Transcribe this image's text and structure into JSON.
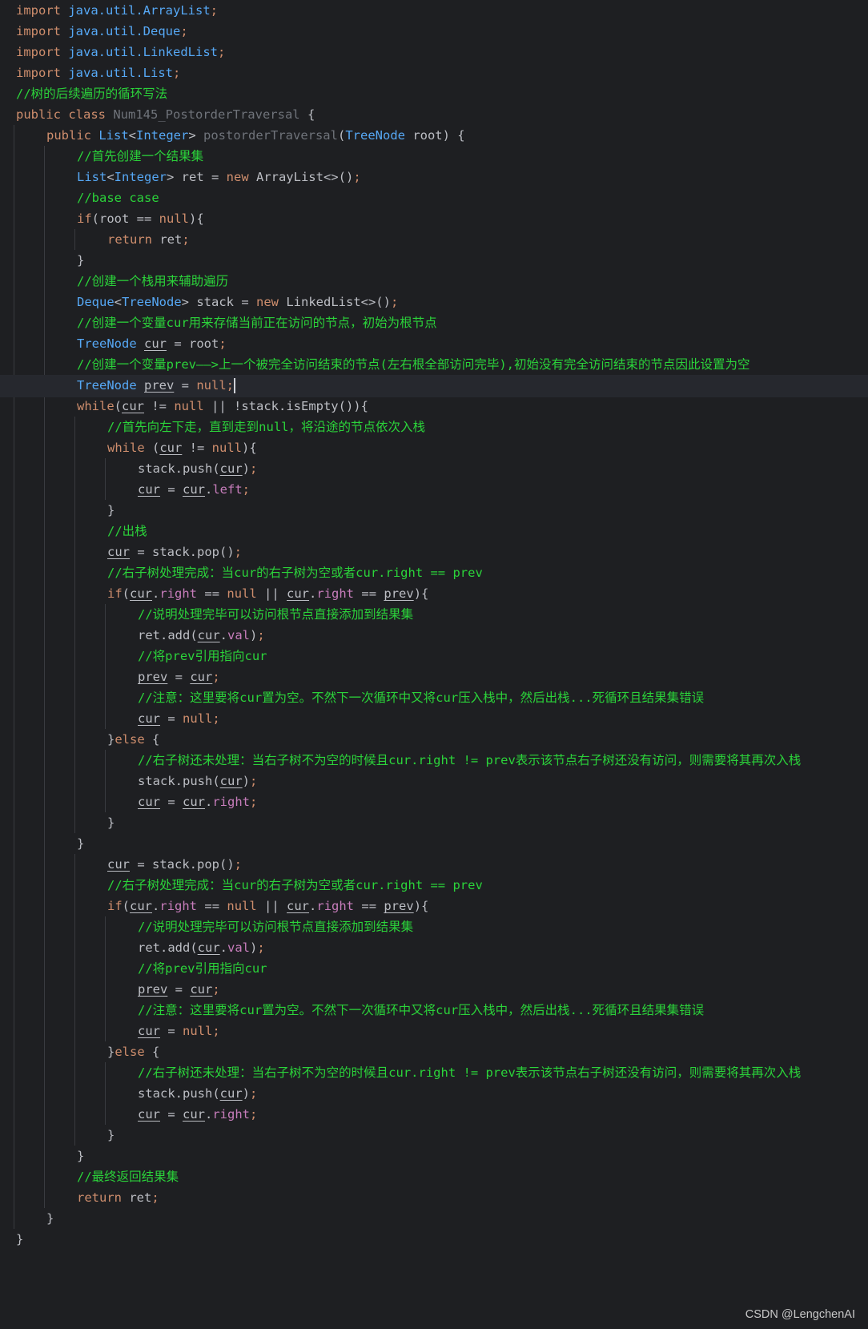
{
  "editor": {
    "lines": [
      {
        "indent": 0,
        "tokens": [
          {
            "t": "import",
            "c": "kw"
          },
          {
            "t": " "
          },
          {
            "t": "java.util.ArrayList",
            "c": "ty"
          },
          {
            "t": ";",
            "c": "kw"
          }
        ]
      },
      {
        "indent": 0,
        "tokens": [
          {
            "t": "import",
            "c": "kw"
          },
          {
            "t": " "
          },
          {
            "t": "java.util.Deque",
            "c": "ty"
          },
          {
            "t": ";",
            "c": "kw"
          }
        ]
      },
      {
        "indent": 0,
        "tokens": [
          {
            "t": "import",
            "c": "kw"
          },
          {
            "t": " "
          },
          {
            "t": "java.util.LinkedList",
            "c": "ty"
          },
          {
            "t": ";",
            "c": "kw"
          }
        ]
      },
      {
        "indent": 0,
        "tokens": [
          {
            "t": "import",
            "c": "kw"
          },
          {
            "t": " "
          },
          {
            "t": "java.util.List",
            "c": "ty"
          },
          {
            "t": ";",
            "c": "kw"
          }
        ]
      },
      {
        "indent": 0,
        "tokens": [
          {
            "t": "//树的后续遍历的循环写法",
            "c": "cm"
          }
        ]
      },
      {
        "indent": 0,
        "tokens": [
          {
            "t": "public class ",
            "c": "kw"
          },
          {
            "t": "Num145_PostorderTraversal",
            "c": "cls"
          },
          {
            "t": " {"
          }
        ]
      },
      {
        "indent": 1,
        "tokens": [
          {
            "t": "public ",
            "c": "kw"
          },
          {
            "t": "List",
            "c": "ty"
          },
          {
            "t": "<"
          },
          {
            "t": "Integer",
            "c": "ty"
          },
          {
            "t": "> "
          },
          {
            "t": "postorderTraversal",
            "c": "cls"
          },
          {
            "t": "("
          },
          {
            "t": "TreeNode",
            "c": "ty"
          },
          {
            "t": " root) {"
          }
        ]
      },
      {
        "indent": 2,
        "tokens": [
          {
            "t": "//首先创建一个结果集",
            "c": "cm"
          }
        ]
      },
      {
        "indent": 2,
        "tokens": [
          {
            "t": "List",
            "c": "ty"
          },
          {
            "t": "<"
          },
          {
            "t": "Integer",
            "c": "ty"
          },
          {
            "t": "> ret = "
          },
          {
            "t": "new ",
            "c": "kw"
          },
          {
            "t": "ArrayList<>()"
          },
          {
            "t": ";",
            "c": "kw"
          }
        ]
      },
      {
        "indent": 2,
        "tokens": [
          {
            "t": "//base case",
            "c": "cm"
          }
        ]
      },
      {
        "indent": 2,
        "tokens": [
          {
            "t": "if",
            "c": "kw"
          },
          {
            "t": "(root == "
          },
          {
            "t": "null",
            "c": "kw"
          },
          {
            "t": "){"
          }
        ]
      },
      {
        "indent": 3,
        "tokens": [
          {
            "t": "return ",
            "c": "kw"
          },
          {
            "t": "ret"
          },
          {
            "t": ";",
            "c": "kw"
          }
        ]
      },
      {
        "indent": 2,
        "tokens": [
          {
            "t": "}"
          }
        ]
      },
      {
        "indent": 2,
        "tokens": [
          {
            "t": "//创建一个栈用来辅助遍历",
            "c": "cm"
          }
        ]
      },
      {
        "indent": 2,
        "tokens": [
          {
            "t": "Deque",
            "c": "ty"
          },
          {
            "t": "<"
          },
          {
            "t": "TreeNode",
            "c": "ty"
          },
          {
            "t": "> stack = "
          },
          {
            "t": "new ",
            "c": "kw"
          },
          {
            "t": "LinkedList<>()"
          },
          {
            "t": ";",
            "c": "kw"
          }
        ]
      },
      {
        "indent": 2,
        "tokens": [
          {
            "t": "//创建一个变量cur用来存储当前正在访问的节点，初始为根节点",
            "c": "cm"
          }
        ]
      },
      {
        "indent": 2,
        "tokens": [
          {
            "t": "TreeNode",
            "c": "ty"
          },
          {
            "t": " "
          },
          {
            "t": "cur",
            "u": 1
          },
          {
            "t": " = root"
          },
          {
            "t": ";",
            "c": "kw"
          }
        ]
      },
      {
        "indent": 2,
        "tokens": [
          {
            "t": "//创建一个变量prev——>上一个被完全访问结束的节点(左右根全部访问完毕),初始没有完全访问结束的节点因此设置为空",
            "c": "cm"
          }
        ]
      },
      {
        "indent": 2,
        "current": true,
        "tokens": [
          {
            "t": "TreeNode",
            "c": "ty"
          },
          {
            "t": " "
          },
          {
            "t": "prev",
            "u": 1
          },
          {
            "t": " = "
          },
          {
            "t": "null",
            "c": "kw"
          },
          {
            "t": ";",
            "c": "kw"
          }
        ]
      },
      {
        "indent": 2,
        "tokens": [
          {
            "t": "while",
            "c": "kw"
          },
          {
            "t": "("
          },
          {
            "t": "cur",
            "u": 1
          },
          {
            "t": " != "
          },
          {
            "t": "null",
            "c": "kw"
          },
          {
            "t": " || !stack.isEmpty()){"
          }
        ]
      },
      {
        "indent": 3,
        "tokens": [
          {
            "t": "//首先向左下走，直到走到null，将沿途的节点依次入栈",
            "c": "cm"
          }
        ]
      },
      {
        "indent": 3,
        "tokens": [
          {
            "t": "while ",
            "c": "kw"
          },
          {
            "t": "("
          },
          {
            "t": "cur",
            "u": 1
          },
          {
            "t": " != "
          },
          {
            "t": "null",
            "c": "kw"
          },
          {
            "t": "){"
          }
        ]
      },
      {
        "indent": 4,
        "tokens": [
          {
            "t": "stack.push("
          },
          {
            "t": "cur",
            "u": 1
          },
          {
            "t": ")"
          },
          {
            "t": ";",
            "c": "kw"
          }
        ]
      },
      {
        "indent": 4,
        "tokens": [
          {
            "t": "cur",
            "u": 1
          },
          {
            "t": " = "
          },
          {
            "t": "cur",
            "u": 1
          },
          {
            "t": "."
          },
          {
            "t": "left",
            "c": "fd"
          },
          {
            "t": ";",
            "c": "kw"
          }
        ]
      },
      {
        "indent": 3,
        "tokens": [
          {
            "t": "}"
          }
        ]
      },
      {
        "indent": 3,
        "tokens": [
          {
            "t": "//出栈",
            "c": "cm"
          }
        ]
      },
      {
        "indent": 3,
        "tokens": [
          {
            "t": "cur",
            "u": 1
          },
          {
            "t": " = stack.pop()"
          },
          {
            "t": ";",
            "c": "kw"
          }
        ]
      },
      {
        "indent": 3,
        "tokens": [
          {
            "t": "//右子树处理完成：当cur的右子树为空或者cur.right == prev",
            "c": "cm"
          }
        ]
      },
      {
        "indent": 3,
        "tokens": [
          {
            "t": "if",
            "c": "kw"
          },
          {
            "t": "("
          },
          {
            "t": "cur",
            "u": 1
          },
          {
            "t": "."
          },
          {
            "t": "right",
            "c": "fd"
          },
          {
            "t": " == "
          },
          {
            "t": "null",
            "c": "kw"
          },
          {
            "t": " || "
          },
          {
            "t": "cur",
            "u": 1
          },
          {
            "t": "."
          },
          {
            "t": "right",
            "c": "fd"
          },
          {
            "t": " == "
          },
          {
            "t": "prev",
            "u": 1
          },
          {
            "t": "){"
          }
        ]
      },
      {
        "indent": 4,
        "tokens": [
          {
            "t": "//说明处理完毕可以访问根节点直接添加到结果集",
            "c": "cm"
          }
        ]
      },
      {
        "indent": 4,
        "tokens": [
          {
            "t": "ret.add("
          },
          {
            "t": "cur",
            "u": 1
          },
          {
            "t": "."
          },
          {
            "t": "val",
            "c": "fd"
          },
          {
            "t": ")"
          },
          {
            "t": ";",
            "c": "kw"
          }
        ]
      },
      {
        "indent": 4,
        "tokens": [
          {
            "t": "//将prev引用指向cur",
            "c": "cm"
          }
        ]
      },
      {
        "indent": 4,
        "tokens": [
          {
            "t": "prev",
            "u": 1
          },
          {
            "t": " = "
          },
          {
            "t": "cur",
            "u": 1
          },
          {
            "t": ";",
            "c": "kw"
          }
        ]
      },
      {
        "indent": 4,
        "tokens": [
          {
            "t": "//注意：这里要将cur置为空。不然下一次循环中又将cur压入栈中，然后出栈...死循环且结果集错误",
            "c": "cm"
          }
        ]
      },
      {
        "indent": 4,
        "tokens": [
          {
            "t": "cur",
            "u": 1
          },
          {
            "t": " = "
          },
          {
            "t": "null",
            "c": "kw"
          },
          {
            "t": ";",
            "c": "kw"
          }
        ]
      },
      {
        "indent": 3,
        "tokens": [
          {
            "t": "}"
          },
          {
            "t": "else ",
            "c": "kw"
          },
          {
            "t": "{"
          }
        ]
      },
      {
        "indent": 4,
        "tokens": [
          {
            "t": "//右子树还未处理：当右子树不为空的时候且cur.right != prev表示该节点右子树还没有访问，则需要将其再次入栈",
            "c": "cm"
          }
        ]
      },
      {
        "indent": 4,
        "tokens": [
          {
            "t": "stack.push("
          },
          {
            "t": "cur",
            "u": 1
          },
          {
            "t": ")"
          },
          {
            "t": ";",
            "c": "kw"
          }
        ]
      },
      {
        "indent": 4,
        "tokens": [
          {
            "t": "cur",
            "u": 1
          },
          {
            "t": " = "
          },
          {
            "t": "cur",
            "u": 1
          },
          {
            "t": "."
          },
          {
            "t": "right",
            "c": "fd"
          },
          {
            "t": ";",
            "c": "kw"
          }
        ]
      },
      {
        "indent": 3,
        "tokens": [
          {
            "t": "}"
          }
        ]
      },
      {
        "indent": 2,
        "tokens": [
          {
            "t": "}"
          }
        ]
      },
      {
        "indent": 3,
        "tokens": [
          {
            "t": "cur",
            "u": 1
          },
          {
            "t": " = stack.pop()"
          },
          {
            "t": ";",
            "c": "kw"
          }
        ]
      },
      {
        "indent": 3,
        "tokens": [
          {
            "t": "//右子树处理完成：当cur的右子树为空或者cur.right == prev",
            "c": "cm"
          }
        ]
      },
      {
        "indent": 3,
        "tokens": [
          {
            "t": "if",
            "c": "kw"
          },
          {
            "t": "("
          },
          {
            "t": "cur",
            "u": 1
          },
          {
            "t": "."
          },
          {
            "t": "right",
            "c": "fd"
          },
          {
            "t": " == "
          },
          {
            "t": "null",
            "c": "kw"
          },
          {
            "t": " || "
          },
          {
            "t": "cur",
            "u": 1
          },
          {
            "t": "."
          },
          {
            "t": "right",
            "c": "fd"
          },
          {
            "t": " == "
          },
          {
            "t": "prev",
            "u": 1
          },
          {
            "t": "){"
          }
        ]
      },
      {
        "indent": 4,
        "tokens": [
          {
            "t": "//说明处理完毕可以访问根节点直接添加到结果集",
            "c": "cm"
          }
        ]
      },
      {
        "indent": 4,
        "tokens": [
          {
            "t": "ret.add("
          },
          {
            "t": "cur",
            "u": 1
          },
          {
            "t": "."
          },
          {
            "t": "val",
            "c": "fd"
          },
          {
            "t": ")"
          },
          {
            "t": ";",
            "c": "kw"
          }
        ]
      },
      {
        "indent": 4,
        "tokens": [
          {
            "t": "//将prev引用指向cur",
            "c": "cm"
          }
        ]
      },
      {
        "indent": 4,
        "tokens": [
          {
            "t": "prev",
            "u": 1
          },
          {
            "t": " = "
          },
          {
            "t": "cur",
            "u": 1
          },
          {
            "t": ";",
            "c": "kw"
          }
        ]
      },
      {
        "indent": 4,
        "tokens": [
          {
            "t": "//注意：这里要将cur置为空。不然下一次循环中又将cur压入栈中，然后出栈...死循环且结果集错误",
            "c": "cm"
          }
        ]
      },
      {
        "indent": 4,
        "tokens": [
          {
            "t": "cur",
            "u": 1
          },
          {
            "t": " = "
          },
          {
            "t": "null",
            "c": "kw"
          },
          {
            "t": ";",
            "c": "kw"
          }
        ]
      },
      {
        "indent": 3,
        "tokens": [
          {
            "t": "}"
          },
          {
            "t": "else ",
            "c": "kw"
          },
          {
            "t": "{"
          }
        ]
      },
      {
        "indent": 4,
        "tokens": [
          {
            "t": "//右子树还未处理：当右子树不为空的时候且cur.right != prev表示该节点右子树还没有访问，则需要将其再次入栈",
            "c": "cm"
          }
        ]
      },
      {
        "indent": 4,
        "tokens": [
          {
            "t": "stack.push("
          },
          {
            "t": "cur",
            "u": 1
          },
          {
            "t": ")"
          },
          {
            "t": ";",
            "c": "kw"
          }
        ]
      },
      {
        "indent": 4,
        "tokens": [
          {
            "t": "cur",
            "u": 1
          },
          {
            "t": " = "
          },
          {
            "t": "cur",
            "u": 1
          },
          {
            "t": "."
          },
          {
            "t": "right",
            "c": "fd"
          },
          {
            "t": ";",
            "c": "kw"
          }
        ]
      },
      {
        "indent": 3,
        "tokens": [
          {
            "t": "}"
          }
        ]
      },
      {
        "indent": 2,
        "tokens": [
          {
            "t": "}"
          }
        ]
      },
      {
        "indent": 2,
        "tokens": [
          {
            "t": "//最终返回结果集",
            "c": "cm"
          }
        ]
      },
      {
        "indent": 2,
        "tokens": [
          {
            "t": "return ",
            "c": "kw"
          },
          {
            "t": "ret"
          },
          {
            "t": ";",
            "c": "kw"
          }
        ]
      },
      {
        "indent": 1,
        "tokens": [
          {
            "t": "}"
          }
        ]
      },
      {
        "indent": 0,
        "tokens": [
          {
            "t": "}"
          }
        ]
      }
    ]
  },
  "colors": {
    "background": "#1e1f22",
    "keyword": "#cf8e6d",
    "type": "#56a8f5",
    "comment": "#2bd33a",
    "field": "#c77dbb",
    "text": "#bcbec4"
  },
  "watermark": "CSDN @LengchenAI"
}
